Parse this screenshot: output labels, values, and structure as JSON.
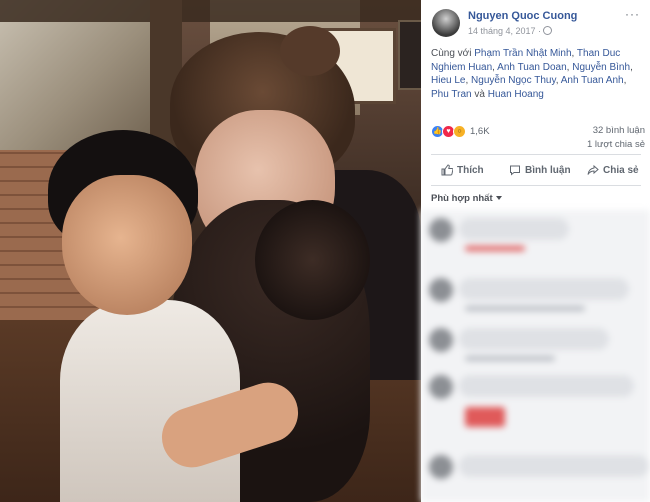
{
  "post": {
    "author": "Nguyen Quoc Cuong",
    "date": "14 tháng 4, 2017 ·",
    "more_label": "···",
    "with_prefix": "Cùng với",
    "tagged": [
      "Phạm Trần Nhật Minh",
      "Than Duc Nghiem Huan",
      "Anh Tuan Doan",
      "Nguyễn Bình",
      "Hieu Le",
      "Nguyễn Ngọc Thuy",
      "Anh Tuan Anh",
      "Phu Tran",
      "Huan Hoang"
    ],
    "and_word": "và"
  },
  "stats": {
    "reaction_count": "1,6K",
    "comments": "32 bình luận",
    "shares": "1 lượt chia sẻ"
  },
  "actions": {
    "like": "Thích",
    "comment": "Bình luận",
    "share": "Chia sẻ"
  },
  "sort": {
    "label": "Phù hợp nhất"
  },
  "colors": {
    "link": "#365899",
    "like": "#3b82f6",
    "love": "#f0284a",
    "wow": "#f7b125",
    "muted": "#606770"
  }
}
